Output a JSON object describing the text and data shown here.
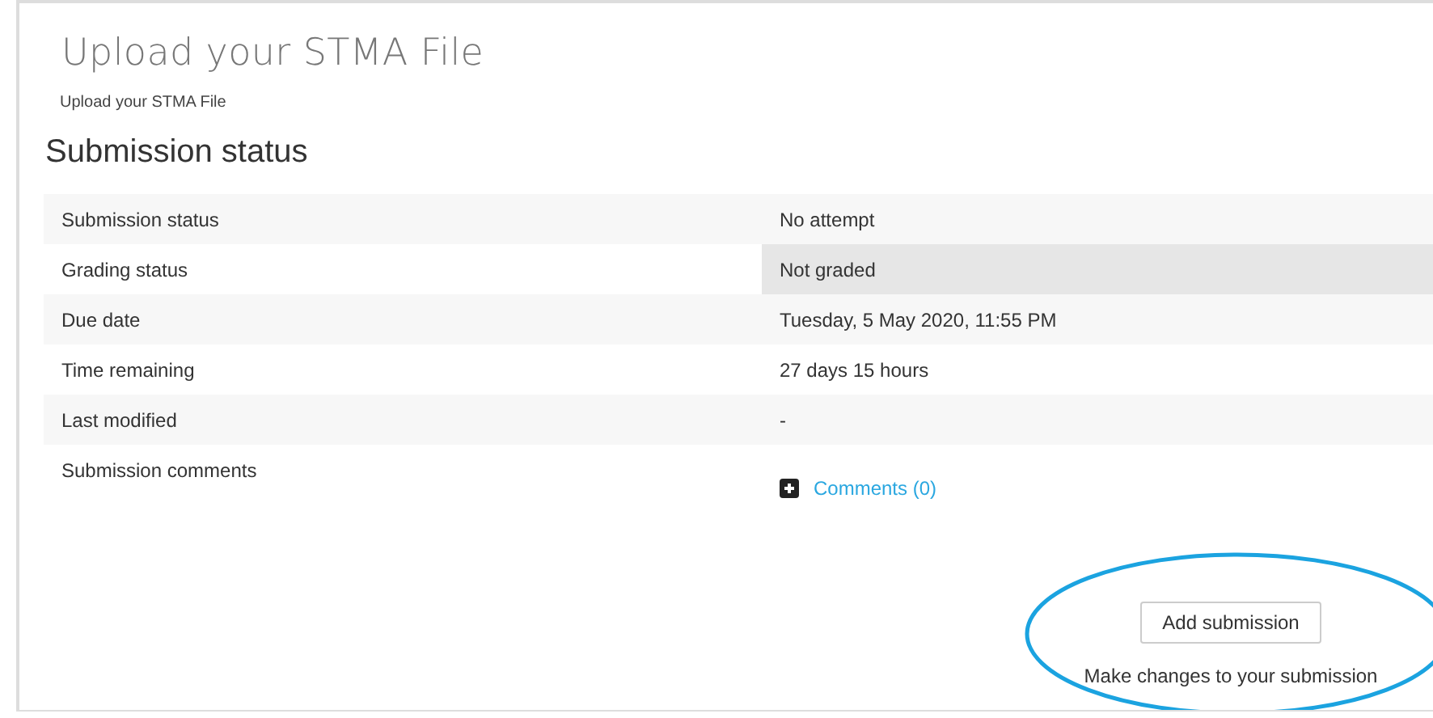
{
  "page_title": "Upload your STMA File",
  "intro": "Upload your STMA File",
  "section_title": "Submission status",
  "rows": [
    {
      "label": "Submission status",
      "value": "No attempt",
      "highlighted": false,
      "kind": "text"
    },
    {
      "label": "Grading status",
      "value": "Not graded",
      "highlighted": true,
      "kind": "text"
    },
    {
      "label": "Due date",
      "value": "Tuesday, 5 May 2020, 11:55 PM",
      "highlighted": false,
      "kind": "text"
    },
    {
      "label": "Time remaining",
      "value": "27 days 15 hours",
      "highlighted": false,
      "kind": "text"
    },
    {
      "label": "Last modified",
      "value": "-",
      "highlighted": false,
      "kind": "text"
    },
    {
      "label": "Submission comments",
      "value": "Comments (0)",
      "highlighted": false,
      "kind": "comments"
    }
  ],
  "action": {
    "button": "Add submission",
    "hint": "Make changes to your submission",
    "circled": true
  }
}
